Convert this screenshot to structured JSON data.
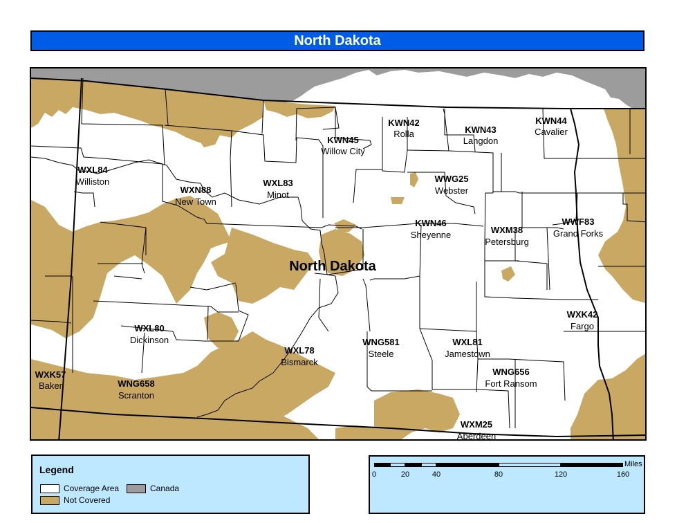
{
  "title": "North Dakota",
  "colors": {
    "title_bar": "#005ce6",
    "coverage_area": "#ffffff",
    "not_covered": "#c9a864",
    "canada": "#9c9c9c",
    "legend_bg": "#bee8ff"
  },
  "map": {
    "state_label": "North Dakota",
    "stations": [
      {
        "code": "KWN42",
        "city": "Rolla"
      },
      {
        "code": "KWN43",
        "city": "Langdon"
      },
      {
        "code": "KWN44",
        "city": "Cavalier"
      },
      {
        "code": "KWN45",
        "city": "Willow City"
      },
      {
        "code": "WXL84",
        "city": "Williston"
      },
      {
        "code": "WXN88",
        "city": "New Town"
      },
      {
        "code": "WXL83",
        "city": "Minot"
      },
      {
        "code": "WWG25",
        "city": "Webster"
      },
      {
        "code": "KWN46",
        "city": "Sheyenne"
      },
      {
        "code": "WXM38",
        "city": "Petersburg"
      },
      {
        "code": "WWF83",
        "city": "Grand Forks"
      },
      {
        "code": "WXL80",
        "city": "Dickinson"
      },
      {
        "code": "WXK42",
        "city": "Fargo"
      },
      {
        "code": "WXL78",
        "city": "Bismarck"
      },
      {
        "code": "WNG581",
        "city": "Steele"
      },
      {
        "code": "WXL81",
        "city": "Jamestown"
      },
      {
        "code": "WXK57",
        "city": "Baker"
      },
      {
        "code": "WNG658",
        "city": "Scranton"
      },
      {
        "code": "WNG656",
        "city": "Fort Ransom"
      },
      {
        "code": "WXM25",
        "city": "Aberdeen"
      }
    ]
  },
  "legend": {
    "title": "Legend",
    "items": [
      {
        "label": "Coverage Area",
        "color": "#ffffff"
      },
      {
        "label": "Canada",
        "color": "#9c9c9c"
      },
      {
        "label": "Not Covered",
        "color": "#c9a864"
      }
    ]
  },
  "scale_bar": {
    "unit": "Miles",
    "ticks": [
      "0",
      "20",
      "40",
      "80",
      "120",
      "160"
    ],
    "tick_values": [
      0,
      20,
      40,
      80,
      120,
      160
    ],
    "max": 160,
    "segments": [
      {
        "from": 0,
        "to": 10,
        "fill": "black"
      },
      {
        "from": 10,
        "to": 20,
        "fill": "light"
      },
      {
        "from": 20,
        "to": 30,
        "fill": "black"
      },
      {
        "from": 30,
        "to": 40,
        "fill": "light"
      },
      {
        "from": 40,
        "to": 80,
        "fill": "black"
      },
      {
        "from": 80,
        "to": 120,
        "fill": "light"
      },
      {
        "from": 120,
        "to": 160,
        "fill": "black"
      }
    ]
  }
}
